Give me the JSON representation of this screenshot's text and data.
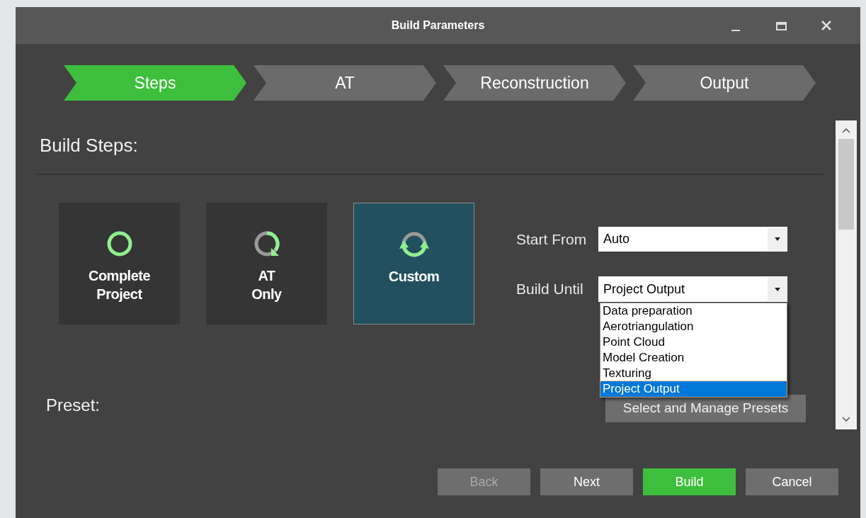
{
  "window": {
    "title": "Build Parameters"
  },
  "steps": [
    {
      "label": "Steps",
      "selected": true
    },
    {
      "label": "AT",
      "selected": false
    },
    {
      "label": "Reconstruction",
      "selected": false
    },
    {
      "label": "Output",
      "selected": false
    }
  ],
  "section_title": "Build Steps:",
  "modes": [
    {
      "kind": "complete",
      "label": "Complete Project",
      "selected": false
    },
    {
      "kind": "at",
      "label": "AT Only",
      "selected": false
    },
    {
      "kind": "custom",
      "label": "Custom",
      "selected": true
    }
  ],
  "start_from": {
    "label": "Start From",
    "value": "Auto"
  },
  "build_until": {
    "label": "Build Until",
    "value": "Project Output",
    "expanded": true,
    "options": [
      {
        "label": "Data preparation",
        "selected": false
      },
      {
        "label": "Aerotriangulation",
        "selected": false
      },
      {
        "label": "Point Cloud",
        "selected": false
      },
      {
        "label": "Model Creation",
        "selected": false
      },
      {
        "label": "Texturing",
        "selected": false
      },
      {
        "label": "Project Output",
        "selected": true
      }
    ]
  },
  "preset": {
    "label": "Preset:",
    "button": "Select and Manage Presets"
  },
  "buttons": [
    {
      "label": "Back",
      "kind": "normal",
      "disabled": true
    },
    {
      "label": "Next",
      "kind": "normal",
      "disabled": false
    },
    {
      "label": "Build",
      "kind": "primary",
      "disabled": false
    },
    {
      "label": "Cancel",
      "kind": "normal",
      "disabled": false
    }
  ]
}
